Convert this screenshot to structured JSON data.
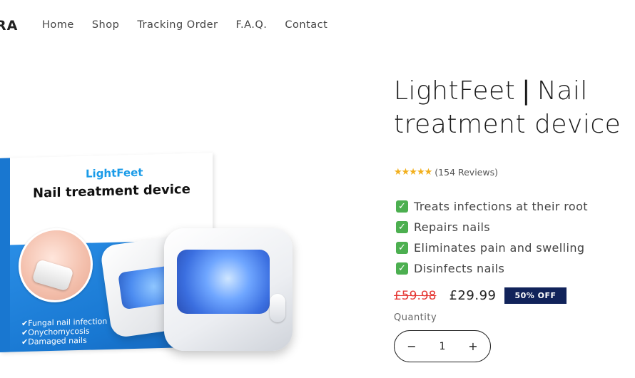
{
  "header": {
    "logo_text": "RA",
    "nav": [
      {
        "label": "Home"
      },
      {
        "label": "Shop"
      },
      {
        "label": "Tracking Order"
      },
      {
        "label": "F.A.Q."
      },
      {
        "label": "Contact"
      }
    ]
  },
  "product_image": {
    "brand": "LightFeet",
    "box_title": "Nail treatment device",
    "box_features": [
      "Fungal nail infection",
      "Onychomycosis",
      "Damaged nails"
    ]
  },
  "product": {
    "title_line1": "LightFeet❘Nail",
    "title_line2": "treatment device",
    "rating": {
      "stars": "★★★★★",
      "value": 5,
      "reviews": "(154 Reviews)"
    },
    "features": [
      {
        "icon": "check-mark-icon",
        "label": "Treats infections at their root"
      },
      {
        "icon": "check-mark-icon",
        "label": "Repairs nails"
      },
      {
        "icon": "check-mark-icon",
        "label": "Eliminates pain and swelling"
      },
      {
        "icon": "check-mark-icon",
        "label": "Disinfects nails"
      }
    ],
    "price_original": "£59.98",
    "price_sale": "£29.99",
    "discount_badge": "50% OFF",
    "quantity": {
      "label": "Quantity",
      "value": "1",
      "minus": "−",
      "plus": "+"
    }
  },
  "colors": {
    "badge_bg": "#11235a",
    "sale_strike": "#e53935",
    "star": "#f2b01e",
    "check_bg": "#4caf50",
    "box_blue": "#1877d1"
  }
}
